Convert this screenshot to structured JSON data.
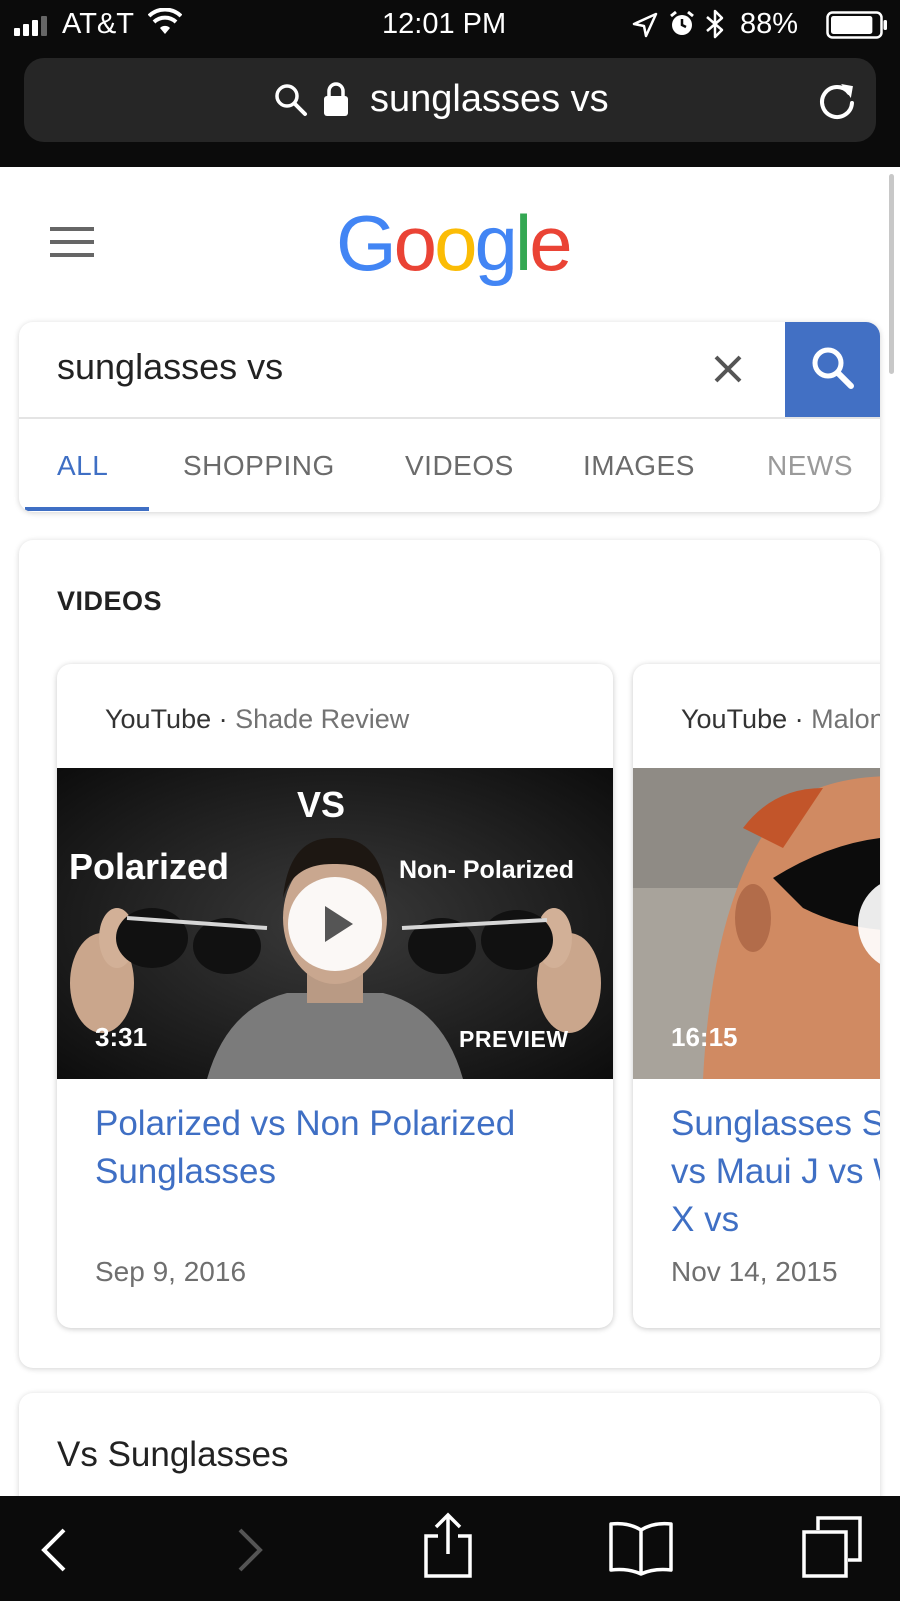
{
  "status": {
    "carrier": "AT&T",
    "time": "12:01 PM",
    "battery": "88%",
    "battery_level": 0.88,
    "icons": [
      "signal-icon",
      "wifi-icon",
      "location-icon",
      "alarm-icon",
      "bluetooth-icon",
      "battery-icon"
    ]
  },
  "browser": {
    "url_text": "sunglasses vs",
    "icons": [
      "search-icon",
      "lock-icon",
      "reload-icon"
    ]
  },
  "logo": {
    "letters": [
      "G",
      "o",
      "o",
      "g",
      "l",
      "e"
    ],
    "colors": [
      "#4285f4",
      "#ea4335",
      "#fbbc05",
      "#4285f4",
      "#34a853",
      "#ea4335"
    ]
  },
  "search": {
    "query": "sunglasses vs",
    "button_color": "#4270c4"
  },
  "tabs": [
    {
      "label": "ALL",
      "active": true
    },
    {
      "label": "SHOPPING"
    },
    {
      "label": "VIDEOS"
    },
    {
      "label": "IMAGES"
    },
    {
      "label": "NEWS"
    }
  ],
  "videos": {
    "heading": "VIDEOS",
    "items": [
      {
        "source": "YouTube",
        "channel": "Shade Review",
        "thumb_labels": {
          "top": "VS",
          "left": "Polarized",
          "right": "Non- Polarized"
        },
        "duration": "3:31",
        "preview": "PREVIEW",
        "title": "Polarized vs Non Polarized Sunglasses",
        "date": "Sep 9, 2016"
      },
      {
        "source": "YouTube",
        "channel": "Malone",
        "duration": "16:15",
        "title": "Sunglasses S Ban vs Maui J vs Wiley-X vs",
        "date": "Nov 14, 2015"
      }
    ]
  },
  "section2": {
    "heading": "Vs Sunglasses"
  },
  "toolbar": {
    "icons": [
      "back-icon",
      "forward-icon",
      "share-icon",
      "bookmarks-icon",
      "tabs-icon"
    ]
  },
  "colors": {
    "link_blue": "#3f6fc4",
    "chrome_bg": "#0b0b0b"
  }
}
